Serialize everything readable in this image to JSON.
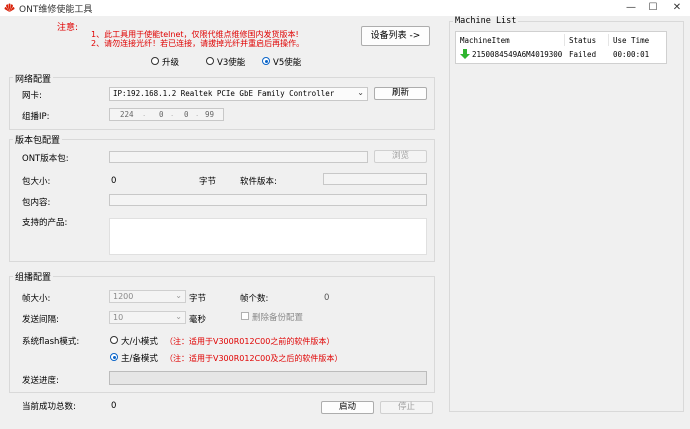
{
  "window": {
    "title": "ONT维修使能工具",
    "minimize": "—",
    "maximize": "☐",
    "close": "✕"
  },
  "notice": {
    "label": "注意:",
    "line1": "1、此工具用于使能telnet，仅限代维点维修国内发货版本!",
    "line2": "2、请勿连接光纤！若已连接，请拔掉光纤并重启后再操作。"
  },
  "device_list_button": "设备列表 ->",
  "mode": {
    "options": [
      "升级",
      "V3使能",
      "V5使能"
    ],
    "selected": 2
  },
  "network": {
    "group_label": "网络配置",
    "nic_label": "网卡:",
    "nic_value": "IP:192.168.1.2 Realtek PCIe GbE Family Controller",
    "refresh_button": "刷新",
    "multicast_ip_label": "组播IP:",
    "multicast_ip": [
      "224",
      "0",
      "0",
      "99"
    ]
  },
  "package": {
    "group_label": "版本包配置",
    "ont_package_label": "ONT版本包:",
    "browse_button": "浏览",
    "size_label": "包大小:",
    "size_value": "0",
    "size_unit": "字节",
    "software_version_label": "软件版本:",
    "contents_label": "包内容:",
    "supported_products_label": "支持的产品:"
  },
  "multicast": {
    "group_label": "组播配置",
    "frame_size_label": "帧大小:",
    "frame_size_value": "1200",
    "frame_size_unit": "字节",
    "frame_count_label": "帧个数:",
    "frame_count_value": "0",
    "interval_label": "发送间隔:",
    "interval_value": "10",
    "interval_unit": "毫秒",
    "delete_backup_label": "删除备份配置",
    "flash_mode_label": "系统flash模式:",
    "flash_options": [
      {
        "label": "大/小模式",
        "note": "（注：适用于V300R012C00之前的软件版本）"
      },
      {
        "label": "主/备模式",
        "note": "（注：适用于V300R012C00及之后的软件版本）"
      }
    ],
    "flash_selected": 1,
    "progress_label": "发送进度:",
    "progress": 0
  },
  "footer": {
    "success_total_label": "当前成功总数:",
    "success_total_value": "0",
    "start_button": "启动",
    "stop_button": "停止"
  },
  "machine_list": {
    "title": "Machine List",
    "columns": [
      "MachineItem",
      "Status",
      "Use Time"
    ],
    "rows": [
      {
        "item": "2150084549A6M4019300",
        "status": "Failed",
        "time": "00:00:01",
        "icon": "green-arrow-down-icon"
      }
    ]
  },
  "colors": {
    "notice_red": "#e00000",
    "accent_blue": "#0a64c8",
    "status_green": "#2fb52f",
    "brand_red": "#d81e06"
  }
}
